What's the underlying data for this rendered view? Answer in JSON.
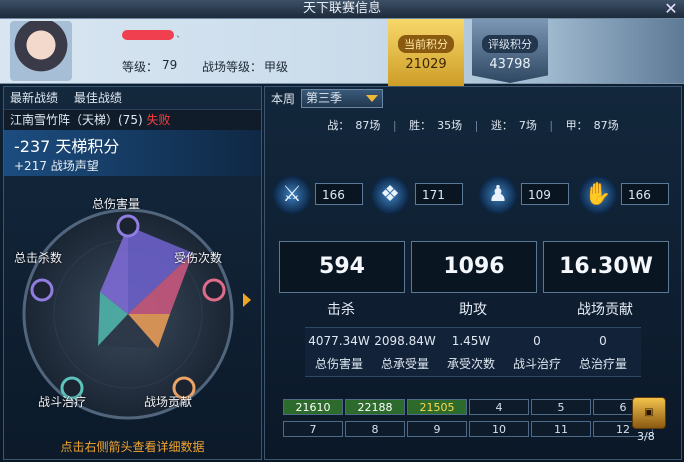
{
  "window": {
    "title": "天下联赛信息",
    "close_glyph": "✕"
  },
  "profile": {
    "name_tail": "ˎ",
    "level_label": "等级：",
    "level": "79",
    "battle_rank_label": "战场等级：",
    "battle_rank": "甲级"
  },
  "badges": {
    "current_label": "当前积分",
    "current_value": "21029",
    "rating_label": "评级积分",
    "rating_value": "43798"
  },
  "left": {
    "tab_latest": "最新战绩",
    "tab_best": "最佳战绩",
    "battle_name": "江南雪竹阵（天梯）(75)",
    "battle_result": "失败",
    "ladder_delta": "-237 天梯积分",
    "reputation_delta": "+217 战场声望",
    "radar": {
      "top": "总伤害量",
      "left": "总击杀数",
      "right": "受伤次数",
      "bottom_left": "战斗治疗",
      "bottom_right": "战场贡献"
    },
    "hint": "点击右侧箭头查看详细数据"
  },
  "right": {
    "week_label": "本周",
    "season": "第三季",
    "counts": [
      {
        "label": "战：",
        "value": "87场"
      },
      {
        "label": "胜：",
        "value": "35场"
      },
      {
        "label": "逃：",
        "value": "7场"
      },
      {
        "label": "甲：",
        "value": "87场"
      }
    ],
    "icon_values": [
      "166",
      "171",
      "109",
      "166"
    ],
    "stats": [
      {
        "value": "594",
        "label": "击杀"
      },
      {
        "value": "1096",
        "label": "助攻"
      },
      {
        "value": "16.30W",
        "label": "战场贡献"
      }
    ],
    "details": [
      {
        "value": "4077.34W",
        "label": "总伤害量"
      },
      {
        "value": "2098.84W",
        "label": "总承受量"
      },
      {
        "value": "1.45W",
        "label": "承受次数"
      },
      {
        "value": "0",
        "label": "战斗治疗"
      },
      {
        "value": "0",
        "label": "总治疗量"
      }
    ],
    "grid": [
      {
        "text": "21610",
        "color": "#ffffff",
        "bg": "#2d6b2d"
      },
      {
        "text": "22188",
        "color": "#ffffff",
        "bg": "#2d6b2d"
      },
      {
        "text": "21505",
        "color": "#ffd84a",
        "bg": "#2d6b2d"
      },
      {
        "text": "4",
        "color": "#d5e1ee",
        "bg": ""
      },
      {
        "text": "5",
        "color": "#d5e1ee",
        "bg": ""
      },
      {
        "text": "6",
        "color": "#d5e1ee",
        "bg": ""
      },
      {
        "text": "7",
        "color": "#d5e1ee",
        "bg": ""
      },
      {
        "text": "8",
        "color": "#d5e1ee",
        "bg": ""
      },
      {
        "text": "9",
        "color": "#d5e1ee",
        "bg": ""
      },
      {
        "text": "10",
        "color": "#d5e1ee",
        "bg": ""
      },
      {
        "text": "11",
        "color": "#d5e1ee",
        "bg": ""
      },
      {
        "text": "12",
        "color": "#d5e1ee",
        "bg": ""
      }
    ],
    "page": "3/8",
    "icons": [
      "crossed-swords-icon",
      "dolphin-icon",
      "warrior-icon",
      "handshake-icon",
      "treasure-chest-icon"
    ]
  },
  "colors": {
    "gold": "#f0a623",
    "fail": "#ff3b3b"
  }
}
